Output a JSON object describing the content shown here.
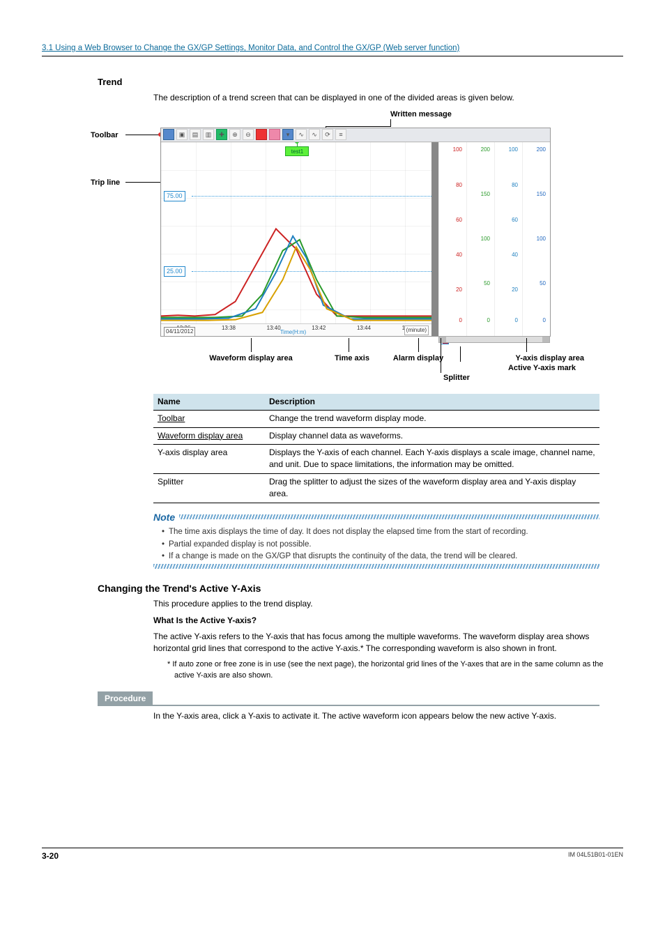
{
  "header": {
    "link": "3.1  Using a Web Browser to Change the GX/GP Settings, Monitor Data, and Control the GX/GP (Web server function)"
  },
  "trend": {
    "title": "Trend",
    "intro": "The description of a trend screen that can be displayed in one of the divided areas is given below.",
    "labels": {
      "toolbar": "Toolbar",
      "tripline": "Trip line",
      "written": "Written message",
      "waveform": "Waveform display area",
      "timeaxis": "Time axis",
      "alarm": "Alarm display",
      "yarea": "Y-axis display area",
      "activemark": "Active Y-axis mark",
      "splitter": "Splitter"
    },
    "trip_value": "75.00",
    "trip_value2": "25.00",
    "written_text": "test1",
    "timeaxis": {
      "ticks": [
        "13:36",
        "13:38",
        "13:40",
        "13:42",
        "13:44",
        "13:46"
      ],
      "unit": "(minute)",
      "label": "Time(H:m)",
      "date": "04/11/2012"
    },
    "yaxes": {
      "col1": {
        "color": "#cc2222",
        "ticks": [
          "100",
          "80",
          "60",
          "40",
          "20",
          "0"
        ]
      },
      "col2": {
        "color": "#2a9a2a",
        "ticks": [
          "200",
          "150",
          "100",
          "50",
          "0"
        ]
      },
      "col3": {
        "color": "#1e7fbf",
        "ticks": [
          "100",
          "80",
          "60",
          "40",
          "20",
          "0"
        ]
      },
      "col4": {
        "color": "#1e66bf",
        "ticks": [
          "200",
          "150",
          "100",
          "50",
          "0"
        ]
      }
    }
  },
  "table": {
    "head": {
      "name": "Name",
      "desc": "Description"
    },
    "rows": [
      {
        "name": "Toolbar",
        "desc": "Change the trend waveform display mode.",
        "underline": true
      },
      {
        "name": "Waveform display area",
        "desc": "Display channel data as waveforms.",
        "underline": true
      },
      {
        "name": "Y-axis display area",
        "desc": "Displays the Y-axis of each channel. Each Y-axis displays a scale image, channel name, and unit. Due to space limitations, the information may be omitted.",
        "underline": false
      },
      {
        "name": "Splitter",
        "desc": "Drag the splitter to adjust the sizes of the waveform display area and Y-axis display area.",
        "underline": false
      }
    ]
  },
  "note": {
    "title": "Note",
    "items": [
      "The time axis displays the time of day. It does not display the elapsed time from the start of recording.",
      "Partial expanded display is not possible.",
      "If a change is made on the GX/GP that disrupts the continuity of the data, the trend will be cleared."
    ]
  },
  "changing": {
    "title": "Changing the Trend's Active Y-Axis",
    "line1": "This procedure applies to the trend display.",
    "subhead": "What Is the Active Y-axis?",
    "para": "The active Y-axis refers to the Y-axis that has focus among the multiple waveforms. The waveform display area shows horizontal grid lines that correspond to the active Y-axis.* The corresponding waveform is also shown in front.",
    "foot": "*   If auto zone or free zone is in use (see the next page), the horizontal grid lines of the Y-axes that are in the same column as the active Y-axis are also shown."
  },
  "procedure": {
    "label": "Procedure",
    "text": "In the Y-axis area, click a Y-axis to activate it. The active waveform icon appears below the new active Y-axis."
  },
  "footer": {
    "page": "3-20",
    "docid": "IM 04L51B01-01EN"
  }
}
